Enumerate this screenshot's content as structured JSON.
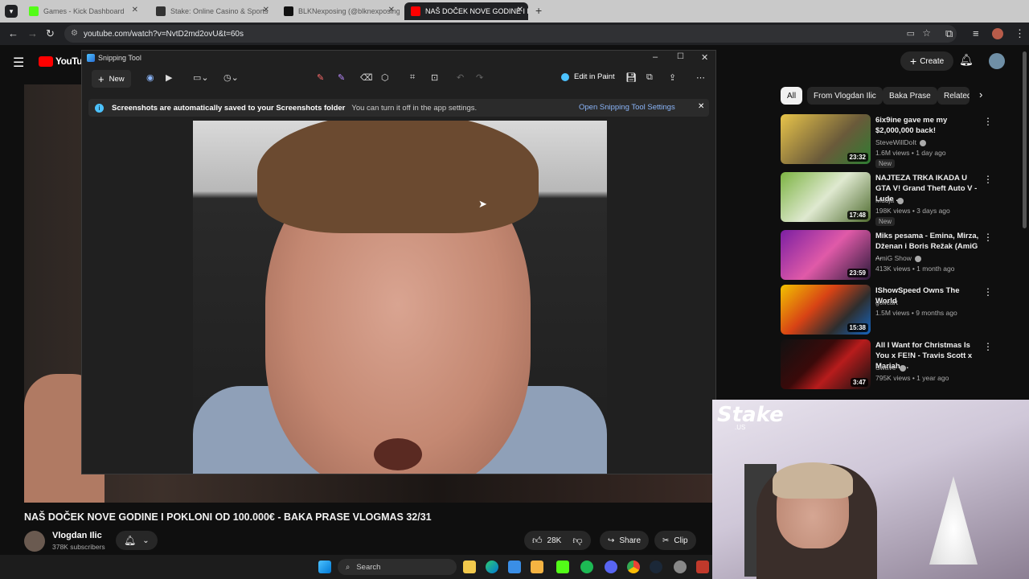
{
  "browser": {
    "tabs": [
      {
        "label": "Games - Kick Dashboard",
        "active": false
      },
      {
        "label": "Stake: Online Casino & Sports",
        "active": false
      },
      {
        "label": "BLKNexposing (@blknexposing)",
        "active": false
      },
      {
        "label": "NAŠ DOČEK NOVE GODINE I P...",
        "active": true
      }
    ],
    "url": "youtube.com/watch?v=NvtD2md2ovU&t=60s"
  },
  "youtube": {
    "logo": "YouTube",
    "create_label": "Create",
    "chips": [
      "All",
      "From Vlogdan Ilic",
      "Baka Prase",
      "Related"
    ],
    "video_title": "NAŠ DOČEK NOVE GODINE I POKLONI OD 100.000€ - BAKA PRASE VLOGMAS 32/31",
    "channel_name": "Vlogdan Ilic",
    "subscribers": "378K subscribers",
    "likes": "28K",
    "share_label": "Share",
    "clip_label": "Clip",
    "recommendations": [
      {
        "title": "6ix9ine gave me my $2,000,000 back!",
        "channel": "SteveWillDoIt",
        "meta": "1.6M views • 1 day ago",
        "badge": "New",
        "duration": "23:32"
      },
      {
        "title": "NAJTEZA TRKA IKADA U GTA V! Grand Theft Auto V - Lude ...",
        "channel": "Mudja",
        "meta": "198K views • 3 days ago",
        "badge": "New",
        "duration": "17:48"
      },
      {
        "title": "Miks pesama - Emina, Mirza, Dženan i Boris Režak (AmiG ...",
        "channel": "AmiG Show",
        "meta": "413K views • 1 month ago",
        "badge": "",
        "duration": "23:59"
      },
      {
        "title": "IShowSpeed Owns The World",
        "channel": "golfcart",
        "meta": "1.5M views • 9 months ago",
        "badge": "",
        "duration": "15:38"
      },
      {
        "title": "All I Want for Christmas Is You x FE!N - Travis Scott x Mariah ...",
        "channel": "Swave",
        "meta": "795K views • 1 year ago",
        "badge": "",
        "duration": "3:47"
      }
    ]
  },
  "snipping_tool": {
    "app_title": "Snipping Tool",
    "new_label": "New",
    "edit_in_paint": "Edit in Paint",
    "info_bold": "Screenshots are automatically saved to your Screenshots folder",
    "info_text": "You can turn it off in the app settings.",
    "settings_link": "Open Snipping Tool Settings"
  },
  "webcam": {
    "brand": "Stake",
    "brand_sub": ".US"
  },
  "taskbar": {
    "search_placeholder": "Search"
  }
}
